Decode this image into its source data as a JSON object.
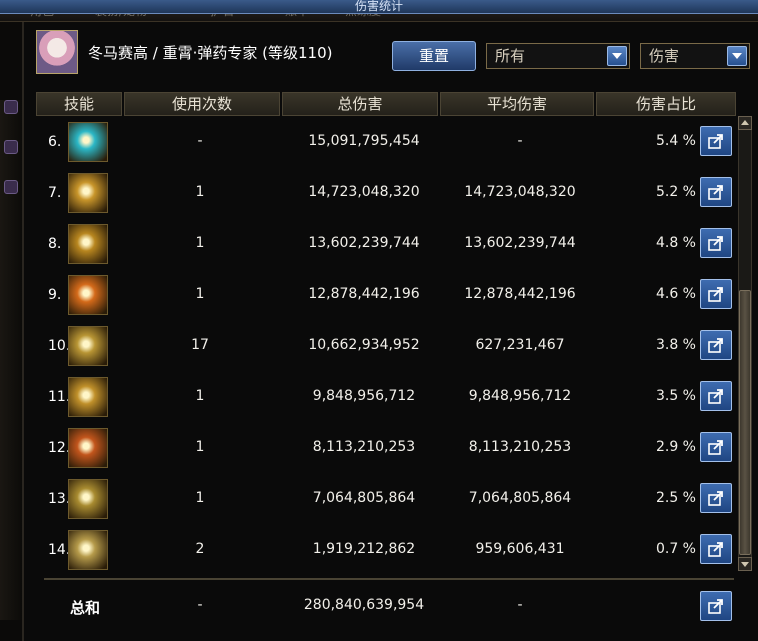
{
  "window": {
    "title": "伤害统计"
  },
  "bg_tabs": [
    "角色",
    "装扮/宠物",
    "护石",
    "账单",
    "熟练度"
  ],
  "character": {
    "name_line": "冬马赛高 / 重霄·弹药专家 (等级110)"
  },
  "controls": {
    "reset_label": "重置",
    "filter_value": "所有",
    "metric_value": "伤害"
  },
  "columns": [
    "技能",
    "使用次数",
    "总伤害",
    "平均伤害",
    "伤害占比"
  ],
  "rows": [
    {
      "rank": "6.",
      "uses": "-",
      "total": "15,091,795,454",
      "avg": "-",
      "pct": "5.4 %",
      "icon": "cyan-burst-skill-icon",
      "color": "#2bb7c6"
    },
    {
      "rank": "7.",
      "uses": "1",
      "total": "14,723,048,320",
      "avg": "14,723,048,320",
      "pct": "5.2 %",
      "icon": "golden-blast-skill-icon",
      "color": "#c8952a"
    },
    {
      "rank": "8.",
      "uses": "1",
      "total": "13,602,239,744",
      "avg": "13,602,239,744",
      "pct": "4.8 %",
      "icon": "golden-explosion-skill-icon",
      "color": "#b8861f"
    },
    {
      "rank": "9.",
      "uses": "1",
      "total": "12,878,442,196",
      "avg": "12,878,442,196",
      "pct": "4.6 %",
      "icon": "fire-rays-skill-icon",
      "color": "#d46a1a"
    },
    {
      "rank": "10.",
      "uses": "17",
      "total": "10,662,934,952",
      "avg": "627,231,467",
      "pct": "3.8 %",
      "icon": "grenade-sparkle-skill-icon",
      "color": "#b89534"
    },
    {
      "rank": "11.",
      "uses": "1",
      "total": "9,848,956,712",
      "avg": "9,848,956,712",
      "pct": "3.5 %",
      "icon": "golden-wave-skill-icon",
      "color": "#c0902a"
    },
    {
      "rank": "12.",
      "uses": "1",
      "total": "8,113,210,253",
      "avg": "8,113,210,253",
      "pct": "2.9 %",
      "icon": "target-ring-skill-icon",
      "color": "#c2551c"
    },
    {
      "rank": "13.",
      "uses": "1",
      "total": "7,064,805,864",
      "avg": "7,064,805,864",
      "pct": "2.5 %",
      "icon": "grenade-cross-skill-icon",
      "color": "#a88b30"
    },
    {
      "rank": "14.",
      "uses": "2",
      "total": "1,919,212,862",
      "avg": "959,606,431",
      "pct": "0.7 %",
      "icon": "shell-sparkle-skill-icon",
      "color": "#b59a4a"
    }
  ],
  "total_row": {
    "label": "总和",
    "uses": "-",
    "total": "280,840,639,954",
    "avg": "-"
  }
}
